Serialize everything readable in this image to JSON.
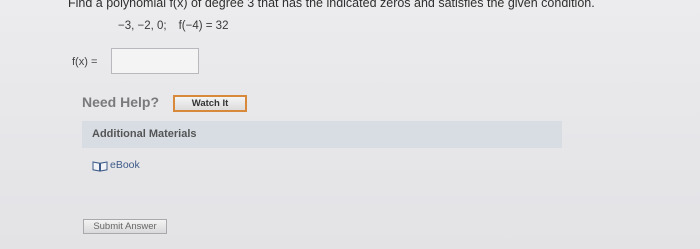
{
  "question": {
    "text": "Find a polynomial f(x) of degree 3 that has the indicated zeros and satisfies the given condition.",
    "zeros": "−3, −2, 0;",
    "condition": "f(−4) = 32"
  },
  "answer": {
    "label": "f(x) =",
    "value": ""
  },
  "help": {
    "heading": "Need Help?",
    "watch_label": "Watch It"
  },
  "materials": {
    "title": "Additional Materials",
    "ebook_label": "eBook",
    "ebook_icon": "book-icon"
  },
  "submit_label": "Submit Answer",
  "colors": {
    "watch_border": "#d88a3a",
    "materials_bar": "#d7dde3",
    "link": "#3d5a88"
  }
}
